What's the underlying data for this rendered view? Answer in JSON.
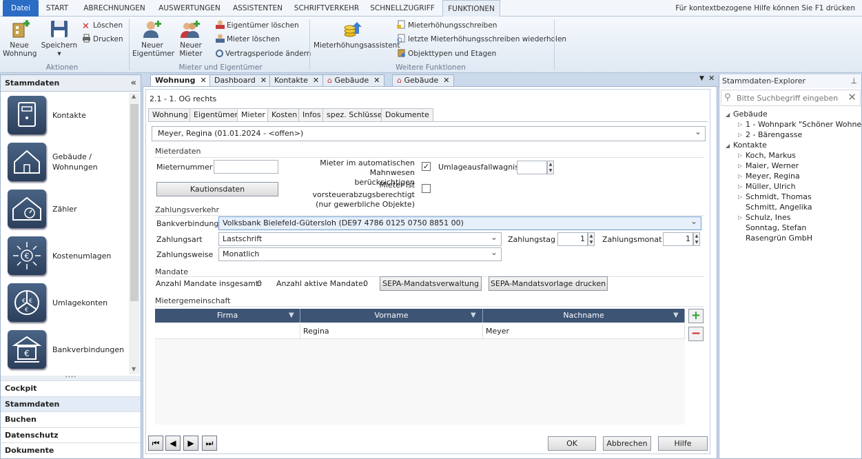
{
  "ribbon_tabs": [
    "Datei",
    "START",
    "ABRECHNUNGEN",
    "AUSWERTUNGEN",
    "ASSISTENTEN",
    "SCHRIFTVERKEHR",
    "SCHNELLZUGRIFF",
    "FUNKTIONEN"
  ],
  "help_hint": "Für kontextbezogene Hilfe können Sie F1 drücken",
  "ribbon": {
    "new_apartment": "Neue\nWohnung",
    "save": "Speichern",
    "delete": "Löschen",
    "print": "Drucken",
    "group_actions": "Aktionen",
    "new_owner": "Neuer\nEigentümer",
    "new_tenant": "Neuer\nMieter",
    "delete_owner": "Eigentümer löschen",
    "delete_tenant": "Mieter löschen",
    "change_contract": "Vertragsperiode ändern",
    "group_tenants": "Mieter und Eigentümer",
    "rent_assistant": "Mieterhöhungsassistent",
    "rent_letter": "Mieterhöhungsschreiben",
    "repeat_letter": "letzte Mieterhöhungsschreiben wiederholen",
    "object_types": "Objekttypen und Etagen",
    "group_more": "Weitere Funktionen"
  },
  "left_panel": {
    "title": "Stammdaten",
    "tiles": [
      "Kontakte",
      "Gebäude /\nWohnungen",
      "Zähler",
      "Kostenumlagen",
      "Umlagekonten",
      "Bankverbindungen"
    ],
    "sections": [
      "Cockpit",
      "Stammdaten",
      "Buchen",
      "Datenschutz",
      "Dokumente"
    ]
  },
  "doc_tabs": [
    "Wohnung",
    "Dashboard",
    "Kontakte",
    "Gebäude",
    "Gebäude"
  ],
  "main": {
    "unit_title": "2.1 - 1. OG rechts",
    "subtabs": [
      "Wohnung",
      "Eigentümer",
      "Mieter",
      "Kosten",
      "Infos",
      "spez. Schlüssel",
      "Dokumente"
    ],
    "tenant_select": "Meyer, Regina (01.01.2024 - <offen>)",
    "section_tenant": "Mieterdaten",
    "tenant_number_label": "Mieternummer",
    "tenant_number_value": "",
    "deposit_button": "Kautionsdaten",
    "dunning_label": "Mieter im automatischen Mahnwesen\nberücksichtigen",
    "dunning_checked": true,
    "loss_label": "Umlageausfallwagnis",
    "loss_value": "",
    "tax_label": "Mieter ist vorsteuerabzugsberechtigt\n(nur gewerbliche Objekte)",
    "tax_checked": false,
    "section_payment": "Zahlungsverkehr",
    "bank_label": "Bankverbindung",
    "bank_value": "Volksbank Bielefeld-Gütersloh (DE97 4786 0125 0750 8851 00)",
    "pay_type_label": "Zahlungsart",
    "pay_type_value": "Lastschrift",
    "pay_day_label": "Zahlungstag",
    "pay_day_value": "1",
    "pay_month_label": "Zahlungsmonat",
    "pay_month_value": "1",
    "pay_mode_label": "Zahlungsweise",
    "pay_mode_value": "Monatlich",
    "section_mandate": "Mandate",
    "mandate_total_label": "Anzahl Mandate insgesamt:",
    "mandate_total": "0",
    "mandate_active_label": "Anzahl aktive Mandate:",
    "mandate_active": "0",
    "sepa_manage": "SEPA-Mandatsverwaltung",
    "sepa_print": "SEPA-Mandatsvorlage drucken",
    "section_community": "Mietergemeinschaft",
    "grid_headers": [
      "Firma",
      "Vorname",
      "Nachname"
    ],
    "grid_row": [
      "",
      "Regina",
      "Meyer"
    ],
    "ok": "OK",
    "cancel": "Abbrechen",
    "help": "Hilfe"
  },
  "explorer": {
    "title": "Stammdaten-Explorer",
    "search_placeholder": "Bitte Suchbegriff eingeben",
    "buildings_label": "Gebäude",
    "buildings": [
      "1 - Wohnpark \"Schöner Wohnen\"",
      "2 - Bärengasse"
    ],
    "contacts_label": "Kontakte",
    "contacts": [
      "Koch, Markus",
      "Maier, Werner",
      "Meyer, Regina",
      "Müller, Ulrich",
      "Schmidt, Thomas",
      "Schmitt, Angelika",
      "Schulz, Ines",
      "Sonntag, Stefan",
      "Rasengrün GmbH"
    ]
  },
  "colors": {
    "accent": "#2b6cc4",
    "tile": "#3a5274",
    "grid_header": "#3d5474",
    "add": "#2fa12f",
    "remove": "#d42020"
  }
}
